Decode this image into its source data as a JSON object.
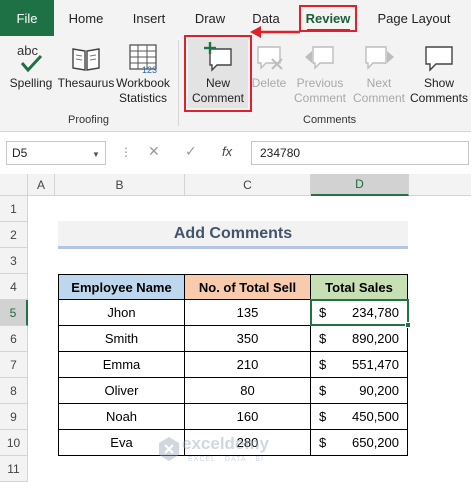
{
  "ribbon_tabs": {
    "file": "File",
    "home": "Home",
    "insert": "Insert",
    "draw": "Draw",
    "data": "Data",
    "review": "Review",
    "page_layout": "Page Layout"
  },
  "proofing": {
    "spelling_label": "Spelling",
    "thesaurus_label": "Thesaurus",
    "workbook_stats_line1": "Workbook",
    "workbook_stats_line2": "Statistics",
    "group_label": "Proofing"
  },
  "comments": {
    "new_line1": "New",
    "new_line2": "Comment",
    "delete_label": "Delete",
    "previous_line1": "Previous",
    "previous_line2": "Comment",
    "next_line1": "Next",
    "next_line2": "Comment",
    "show_line1": "Show",
    "show_line2": "Comments",
    "group_label": "Comments"
  },
  "formula_bar": {
    "name_box": "D5",
    "fx": "fx",
    "value": "234780"
  },
  "grid": {
    "columns": [
      "A",
      "B",
      "C",
      "D"
    ],
    "rows": [
      "1",
      "2",
      "3",
      "4",
      "5",
      "6",
      "7",
      "8",
      "9",
      "10",
      "11"
    ],
    "title": "Add Comments",
    "headers": [
      "Employee Name",
      "No. of Total Sell",
      "Total Sales"
    ],
    "currency": "$",
    "table": [
      {
        "name": "Jhon",
        "sell": "135",
        "sales": "234,780"
      },
      {
        "name": "Smith",
        "sell": "350",
        "sales": "890,200"
      },
      {
        "name": "Emma",
        "sell": "210",
        "sales": "551,470"
      },
      {
        "name": "Oliver",
        "sell": "80",
        "sales": "90,200"
      },
      {
        "name": "Noah",
        "sell": "160",
        "sales": "450,500"
      },
      {
        "name": "Eva",
        "sell": "280",
        "sales": "650,200"
      }
    ]
  },
  "watermark": {
    "brand": "exceldemy",
    "tagline": "EXCEL · DATA · BI"
  },
  "colors": {
    "excel_green": "#1E7145",
    "highlight_red": "#E0202A",
    "header_blue": "#BDD7EE",
    "header_orange": "#F8CBAD",
    "header_green": "#C6E0B4"
  }
}
